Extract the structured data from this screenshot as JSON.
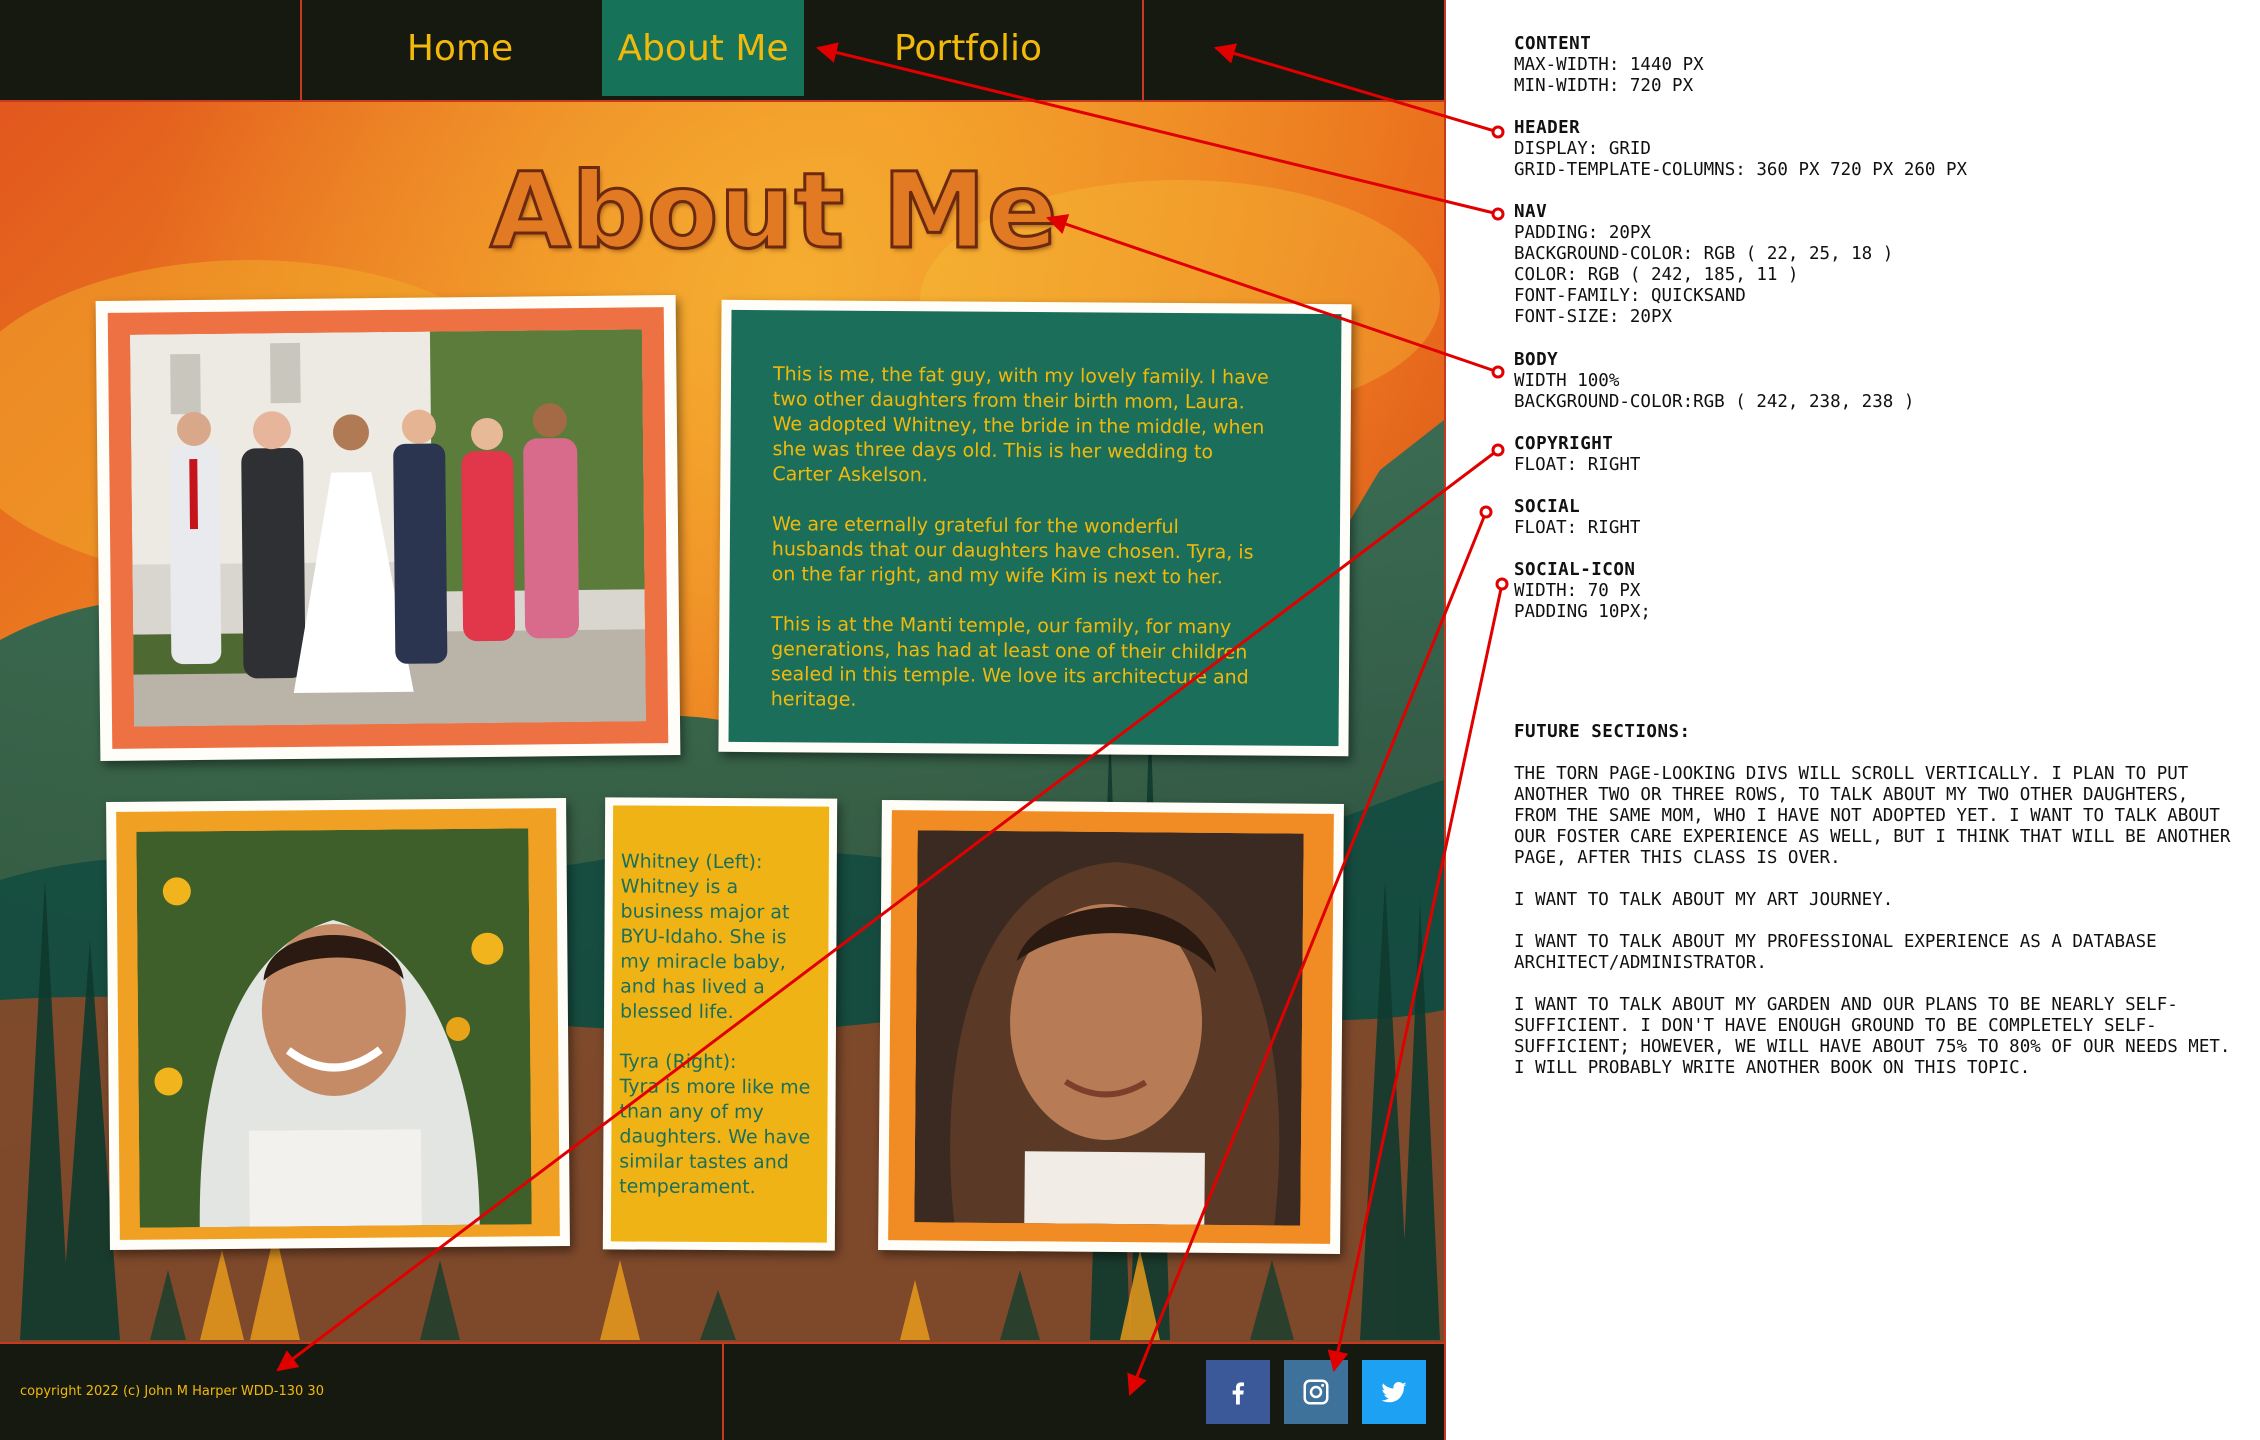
{
  "nav": {
    "items": [
      {
        "label": "Home"
      },
      {
        "label": "About Me",
        "active": true
      },
      {
        "label": "Portfolio"
      }
    ]
  },
  "page_title": "About Me",
  "about_text": {
    "p1": "This is me, the fat guy, with my lovely family. I have two other daughters from their birth mom, Laura. We adopted Whitney, the bride in the middle, when she was three days old. This is her wedding to Carter Askelson.",
    "p2": "We are eternally grateful for the wonderful husbands that our daughters have chosen. Tyra, is on the far right, and my wife Kim is next to her.",
    "p3": "This is at the Manti temple, our family, for many generations, has had at least one of their children sealed in this temple. We love its architecture and heritage."
  },
  "daughters_text": {
    "whitney_heading": "Whitney (Left):",
    "whitney_body": "Whitney is a business major at BYU-Idaho. She is my miracle baby, and has lived a blessed life.",
    "tyra_heading": "Tyra (Right):",
    "tyra_body": "Tyra is more like me than any of my daughters. We have similar tastes and temperament."
  },
  "footer": {
    "copyright": "copyright 2022 (c) John M Harper WDD-130 30",
    "social": [
      {
        "icon": "facebook-icon",
        "color": "#3b5998"
      },
      {
        "icon": "instagram-icon",
        "color": "#3f729b"
      },
      {
        "icon": "twitter-icon",
        "color": "#1da1f2"
      }
    ]
  },
  "notes": {
    "content": {
      "title": "Content",
      "lines": [
        "max-width: 1440 px",
        "min-width: 720 px"
      ]
    },
    "header": {
      "title": "Header",
      "lines": [
        "display: grid",
        "grid-template-columns: 360 px 720 px 260 px"
      ]
    },
    "nav": {
      "title": "Nav",
      "lines": [
        "padding: 20px",
        "background-color: rgb ( 22, 25, 18 )",
        "color: rgb ( 242, 185, 11 )",
        "font-family: quicksand",
        "font-size: 20px"
      ]
    },
    "body": {
      "title": "Body",
      "lines": [
        "width 100%",
        "background-color:rgb ( 242, 238, 238 )"
      ]
    },
    "copyright": {
      "title": "Copyright",
      "lines": [
        "float: right"
      ]
    },
    "social": {
      "title": "Social",
      "lines": [
        "float: right"
      ]
    },
    "social_icon": {
      "title": "Social-icon",
      "lines": [
        "width: 70 px",
        "padding 10px;"
      ]
    }
  },
  "future": {
    "title": "Future Sections:",
    "p1": "The torn page-looking divs will scroll vertically. I plan to put another two or three rows, to talk about my two other daughters, from the same mom, who I have not adopted yet. I want to talk about our foster care experience as well, but I think that will be another page, after this class is over.",
    "p2": "I want to talk about my art journey.",
    "p3": "I want to talk about my professional experience as a database architect/administrator.",
    "p4": "I want to talk about my garden and our plans to be nearly self-sufficient. I don't have enough ground to be completely self-sufficient; however, we will have about 75% to 80% of our needs met. I will probably write another book on this topic."
  }
}
